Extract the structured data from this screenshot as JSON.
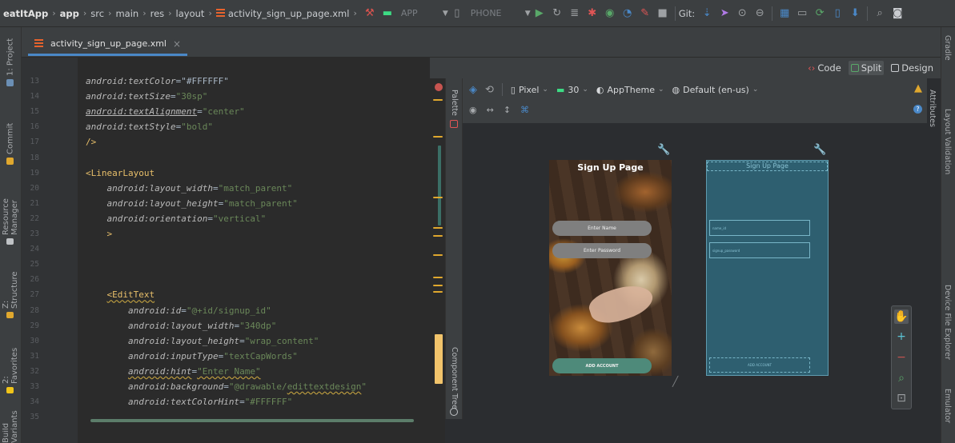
{
  "nav": {
    "crumbs": [
      "eatItApp",
      "app",
      "src",
      "main",
      "res",
      "layout",
      "activity_sign_up_page.xml"
    ],
    "run_config": "APP",
    "device": "PHONE",
    "git_label": "Git:"
  },
  "tabs": {
    "file": "activity_sign_up_page.xml",
    "close": "×"
  },
  "left_tools": [
    "1: Project",
    "Commit",
    "Resource Manager",
    "Z: Structure",
    "2: Favorites",
    "Build Variants"
  ],
  "right_tools": [
    "Gradle",
    "Layout Validation",
    "Device File Explorer",
    "Emulator"
  ],
  "side_tools": {
    "palette": "Palette",
    "component_tree": "Component Tree",
    "attributes": "Attributes"
  },
  "view_modes": {
    "code": "Code",
    "split": "Split",
    "design": "Design"
  },
  "design_toolbar": {
    "device": "Pixel",
    "api": "30",
    "theme": "AppTheme",
    "locale": "Default (en-us)"
  },
  "code_lines": [
    {
      "num": "13",
      "parts": [
        [
          "attr",
          "android:textColor"
        ],
        [
          "plain",
          "=\"#FFFFFF\""
        ]
      ]
    },
    {
      "num": "14",
      "parts": [
        [
          "attr",
          "android:textSize"
        ],
        [
          "plain",
          "="
        ],
        [
          "str",
          "\"30sp\""
        ]
      ]
    },
    {
      "num": "15",
      "parts": [
        [
          "attr ul",
          "android:textAlignment"
        ],
        [
          "plain",
          "="
        ],
        [
          "str",
          "\"center\""
        ]
      ]
    },
    {
      "num": "16",
      "parts": [
        [
          "attr",
          "android:textStyle"
        ],
        [
          "plain",
          "="
        ],
        [
          "str",
          "\"bold\""
        ]
      ]
    },
    {
      "num": "17",
      "parts": [
        [
          "tag",
          "/>"
        ]
      ]
    },
    {
      "num": "18",
      "parts": []
    },
    {
      "num": "19",
      "parts": [
        [
          "tag",
          "<LinearLayout"
        ]
      ]
    },
    {
      "num": "20",
      "parts": [
        [
          "pad",
          "    "
        ],
        [
          "attr",
          "android:layout_width"
        ],
        [
          "plain",
          "="
        ],
        [
          "str",
          "\"match_parent\""
        ]
      ]
    },
    {
      "num": "21",
      "parts": [
        [
          "pad",
          "    "
        ],
        [
          "attr",
          "android:layout_height"
        ],
        [
          "plain",
          "="
        ],
        [
          "str",
          "\"match_parent\""
        ]
      ]
    },
    {
      "num": "22",
      "parts": [
        [
          "pad",
          "    "
        ],
        [
          "attr",
          "android:orientation"
        ],
        [
          "plain",
          "="
        ],
        [
          "str",
          "\"vertical\""
        ]
      ]
    },
    {
      "num": "23",
      "parts": [
        [
          "pad",
          "    "
        ],
        [
          "tag",
          ">"
        ]
      ]
    },
    {
      "num": "24",
      "parts": []
    },
    {
      "num": "25",
      "parts": []
    },
    {
      "num": "26",
      "parts": []
    },
    {
      "num": "27",
      "parts": [
        [
          "pad",
          "    "
        ],
        [
          "tag sq",
          "<EditText"
        ]
      ]
    },
    {
      "num": "28",
      "parts": [
        [
          "pad",
          "        "
        ],
        [
          "attr",
          "android:id"
        ],
        [
          "plain",
          "="
        ],
        [
          "str",
          "\"@+id/signup_id\""
        ]
      ]
    },
    {
      "num": "29",
      "parts": [
        [
          "pad",
          "        "
        ],
        [
          "attr",
          "android:layout_width"
        ],
        [
          "plain",
          "="
        ],
        [
          "str",
          "\"340dp\""
        ]
      ]
    },
    {
      "num": "30",
      "parts": [
        [
          "pad",
          "        "
        ],
        [
          "attr",
          "android:layout_height"
        ],
        [
          "plain",
          "="
        ],
        [
          "str",
          "\"wrap_content\""
        ]
      ]
    },
    {
      "num": "31",
      "parts": [
        [
          "pad",
          "        "
        ],
        [
          "attr",
          "android:inputType"
        ],
        [
          "plain",
          "="
        ],
        [
          "str",
          "\"textCapWords\""
        ]
      ]
    },
    {
      "num": "32",
      "parts": [
        [
          "pad",
          "        "
        ],
        [
          "attr sq",
          "android:hint"
        ],
        [
          "plain",
          "="
        ],
        [
          "str sq",
          "\"Enter Name\""
        ]
      ]
    },
    {
      "num": "33",
      "parts": [
        [
          "pad",
          "        "
        ],
        [
          "attr",
          "android:background"
        ],
        [
          "plain",
          "="
        ],
        [
          "str",
          "\"@drawable/"
        ],
        [
          "str sq",
          "edittextdesign"
        ],
        [
          "str",
          "\""
        ]
      ]
    },
    {
      "num": "34",
      "parts": [
        [
          "pad",
          "        "
        ],
        [
          "attr",
          "android:textColorHint"
        ],
        [
          "plain",
          "="
        ],
        [
          "str",
          "\"#FFFFFF\""
        ]
      ]
    },
    {
      "num": "35",
      "parts": []
    }
  ],
  "preview": {
    "title": "Sign Up Page",
    "name_hint": "Enter Name",
    "password_hint": "Enter Password",
    "button": "ADD ACCOUNT"
  },
  "blueprint": {
    "title": "Sign Up Page",
    "field1": "name_id",
    "field2": "signup_password",
    "button": "ADD ACCOUNT"
  },
  "colors": {
    "accent": "#4a88c7",
    "string": "#6a8759",
    "tag": "#e8bf6a",
    "attribute": "#bababa"
  }
}
